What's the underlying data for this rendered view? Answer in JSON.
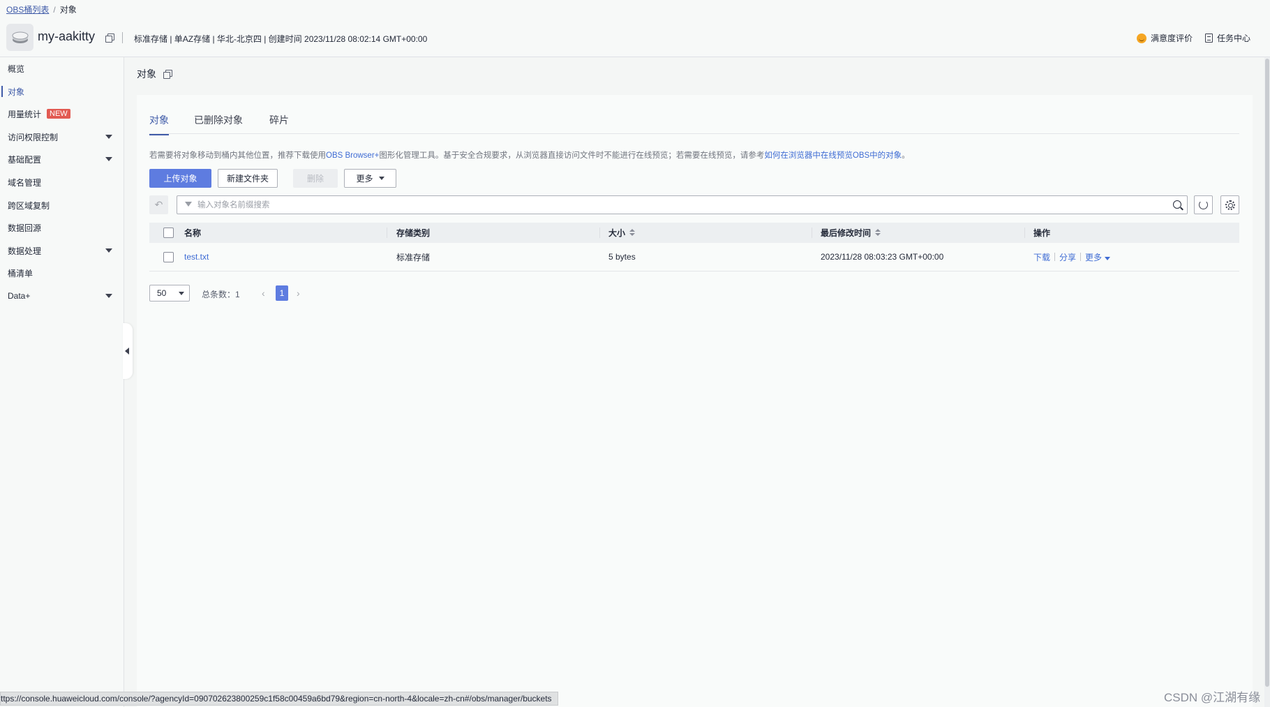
{
  "breadcrumb": {
    "root": "OBS桶列表",
    "separator": "/",
    "current": "对象"
  },
  "bucket": {
    "name": "my-aakitty",
    "meta": "标准存储 | 单AZ存储 | 华北-北京四 | 创建时间  2023/11/28 08:02:14 GMT+00:00"
  },
  "header_actions": {
    "satisfaction": "满意度评价",
    "task_center": "任务中心"
  },
  "sidebar": {
    "items": [
      {
        "label": "概览"
      },
      {
        "label": "对象"
      },
      {
        "label": "用量统计",
        "badge": "NEW"
      },
      {
        "label": "访问权限控制"
      },
      {
        "label": "基础配置"
      },
      {
        "label": "域名管理"
      },
      {
        "label": "跨区域复制"
      },
      {
        "label": "数据回源"
      },
      {
        "label": "数据处理"
      },
      {
        "label": "桶清单"
      },
      {
        "label": "Data+"
      }
    ]
  },
  "page_title": "对象",
  "tabs": [
    "对象",
    "已删除对象",
    "碎片"
  ],
  "notice": {
    "text_before": "若需要将对象移动到桶内其他位置，推荐下载使用",
    "link1": "OBS Browser+",
    "text_middle": "图形化管理工具。基于安全合规要求，从浏览器直接访问文件时不能进行在线预览；若需要在线预览，请参考",
    "link2": "如何在浏览器中在线预览OBS中的对象",
    "text_after": "。"
  },
  "toolbar": {
    "upload": "上传对象",
    "new_folder": "新建文件夹",
    "delete": "删除",
    "more": "更多"
  },
  "search": {
    "placeholder": "输入对象名前缀搜索",
    "value": ""
  },
  "table": {
    "headers": {
      "name": "名称",
      "storage_class": "存储类别",
      "size": "大小",
      "modified": "最后修改时间",
      "actions": "操作"
    },
    "rows": [
      {
        "name": "test.txt",
        "storage_class": "标准存储",
        "size": "5 bytes",
        "modified": "2023/11/28 08:03:23 GMT+00:00",
        "actions": {
          "download": "下载",
          "share": "分享",
          "more": "更多"
        }
      }
    ]
  },
  "pagination": {
    "page_size": "50",
    "total": "总条数：1",
    "current_page": "1"
  },
  "status_url": "ttps://console.huaweicloud.com/console/?agencyId=090702623800259c1f58c00459a6bd79&region=cn-north-4&locale=zh-cn#/obs/manager/buckets",
  "watermark": "CSDN @江湖有缘",
  "colors": {
    "accent": "#5e7ce0",
    "link": "#3f6cd4",
    "badge": "#e25a52"
  }
}
